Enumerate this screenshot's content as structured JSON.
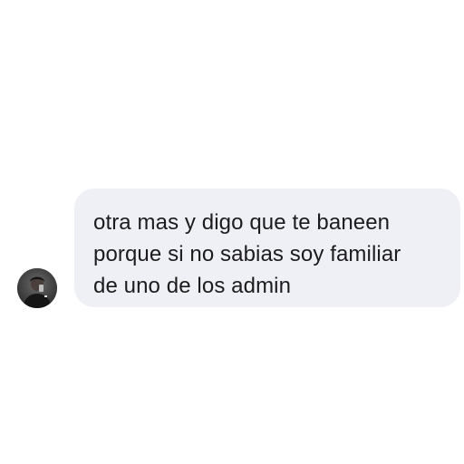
{
  "conversation": {
    "incoming_message": {
      "sender_avatar_icon": "user-avatar-photo",
      "bubble_color": "#eff0f5",
      "text_color": "#1c1c1e",
      "lines": [
        "otra mas y digo que te baneen",
        "porque si no sabias soy familiar",
        "de uno de los admin"
      ]
    }
  }
}
